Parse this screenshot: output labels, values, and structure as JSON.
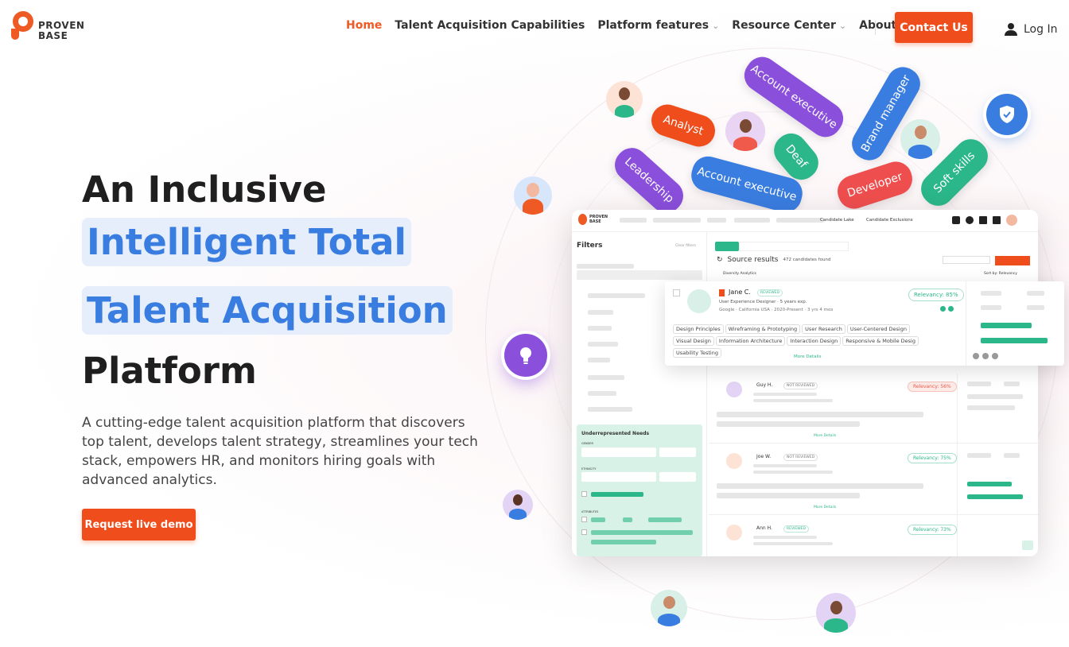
{
  "brand": {
    "line1": "PROVEN",
    "line2": "BASE",
    "accent": "#ef4e1c"
  },
  "nav": {
    "items": [
      {
        "label": "Home",
        "active": true,
        "dropdown": false
      },
      {
        "label": "Talent Acquisition Capabilities",
        "dropdown": false
      },
      {
        "label": "Platform features",
        "dropdown": true
      },
      {
        "label": "Resource Center",
        "dropdown": true
      },
      {
        "label": "About Us",
        "dropdown": true
      }
    ],
    "contact": "Contact Us",
    "login": "Log In"
  },
  "hero": {
    "line1": "An Inclusive",
    "line2": "Intelligent Total",
    "line3": "Talent Acquisition",
    "line4": "Platform",
    "description": "A cutting-edge talent acquisition platform that discovers top talent, develops talent strategy, streamlines your tech stack, empowers HR, and monitors hiring goals with advanced analytics.",
    "cta": "Request live demo",
    "highlight_color": "#3a7de0"
  },
  "pills": [
    {
      "label": "Analyst",
      "color": "#ef4e1c"
    },
    {
      "label": "Account executive",
      "color": "#8a4fdb"
    },
    {
      "label": "Brand manager",
      "color": "#3a7de0"
    },
    {
      "label": "Deaf",
      "color": "#2bb789"
    },
    {
      "label": "Leadership",
      "color": "#8a4fdb"
    },
    {
      "label": "Account executive",
      "color": "#3a7de0"
    },
    {
      "label": "Developer",
      "color": "#ef4e4e"
    },
    {
      "label": "Soft skills",
      "color": "#2bb789"
    }
  ],
  "dashboard": {
    "logo_line1": "PROVEN",
    "logo_line2": "BASE",
    "header_text1": "Candidate Lake",
    "header_text2": "Candidate Exclusions",
    "filters_title": "Filters",
    "clear_filters": "Clear filters",
    "source_results": "Source results",
    "candidates_found": "472 candidates found",
    "diversity": "Diversity Analytics",
    "sort": "Sort by: Relevancy",
    "underrepresented": "Underrepresented Needs",
    "gender": "GENDER",
    "ethnicity": "ETHNICITY",
    "attributes": "ATTRIBUTES",
    "more_details": "More Details",
    "featured": {
      "name": "Jane C.",
      "status": "REVIEWED",
      "relevancy": "Relevancy: 85%",
      "role": "User Experience Designer · 5 years exp.",
      "company": "Google · California USA · 2020-Present · 3 yrs 4 mos",
      "skills": [
        "Design Principles",
        "Wireframing & Prototyping",
        "User Research",
        "User-Centered Design",
        "Visual Design",
        "Information Architecture",
        "Interaction Design",
        "Responsive & Mobile Desig",
        "Usability Testing"
      ]
    },
    "candidates": [
      {
        "name": "Guy H.",
        "status": "NOT REVIEWED",
        "relevancy": "Relevancy: 56%",
        "rel_color": "#ef5a4a"
      },
      {
        "name": "Joe W.",
        "status": "NOT REVIEWED",
        "relevancy": "Relevancy: 75%",
        "rel_color": "#2bb789"
      },
      {
        "name": "Ann H.",
        "status": "REVIEWED",
        "relevancy": "Relevancy: 73%",
        "rel_color": "#2bb789"
      }
    ]
  }
}
